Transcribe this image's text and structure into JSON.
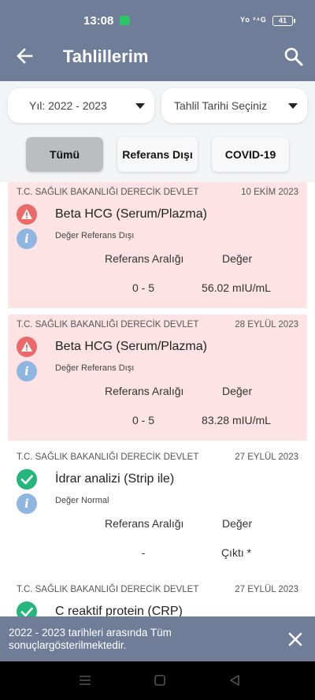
{
  "status_bar": {
    "time": "13:08",
    "signal_text": "Yo ²⁴G ",
    "battery": "41"
  },
  "app_bar": {
    "title": "Tahlillerim",
    "back_icon": "arrow-left-icon",
    "search_icon": "search-icon"
  },
  "filters": {
    "year_label": "Yıl: 2022 - 2023",
    "date_placeholder": "Tahlil Tarihi Seçiniz"
  },
  "tabs": [
    {
      "label": "Tümü",
      "selected": true
    },
    {
      "label": "Referans Dışı",
      "selected": false
    },
    {
      "label": "COVID-19",
      "selected": false
    }
  ],
  "column_headers": {
    "reference": "Referans Aralığı",
    "value": "Değer"
  },
  "results": [
    {
      "institution": "T.C. SAĞLIK BAKANLIĞI DERECİK DEVLET",
      "date": "10 EKİM 2023",
      "test_name": "Beta HCG (Serum/Plazma)",
      "status_text": "Değer Referans Dışı",
      "status": "abnormal",
      "reference": "0 - 5",
      "value": "56.02 mIU/mL"
    },
    {
      "institution": "T.C. SAĞLIK BAKANLIĞI DERECİK DEVLET",
      "date": "28 EYLÜL 2023",
      "test_name": "Beta HCG (Serum/Plazma)",
      "status_text": "Değer Referans Dışı",
      "status": "abnormal",
      "reference": "0 - 5",
      "value": "83.28 mIU/mL"
    },
    {
      "institution": "T.C. SAĞLIK BAKANLIĞI DERECİK DEVLET",
      "date": "27 EYLÜL 2023",
      "test_name": "İdrar analizi (Strip ile)",
      "status_text": "Değer Normal",
      "status": "normal",
      "reference": "-",
      "value": "Çıktı *"
    },
    {
      "institution": "T.C. SAĞLIK BAKANLIĞI DERECİK DEVLET",
      "date": "27 EYLÜL 2023",
      "test_name": "C reaktif protein (CRP)",
      "status_text": "",
      "status": "normal",
      "reference": "",
      "value": ""
    }
  ],
  "snackbar": {
    "message": "2022 - 2023 tarihleri arasında Tüm sonuçlargösterilmektedir.",
    "close_icon": "close-icon"
  },
  "colors": {
    "primary": "#6f7d99",
    "abnormal_bg": "#fde3e4",
    "warning": "#ea6a6a",
    "normal": "#26b57c",
    "info": "#8fb6e0"
  }
}
